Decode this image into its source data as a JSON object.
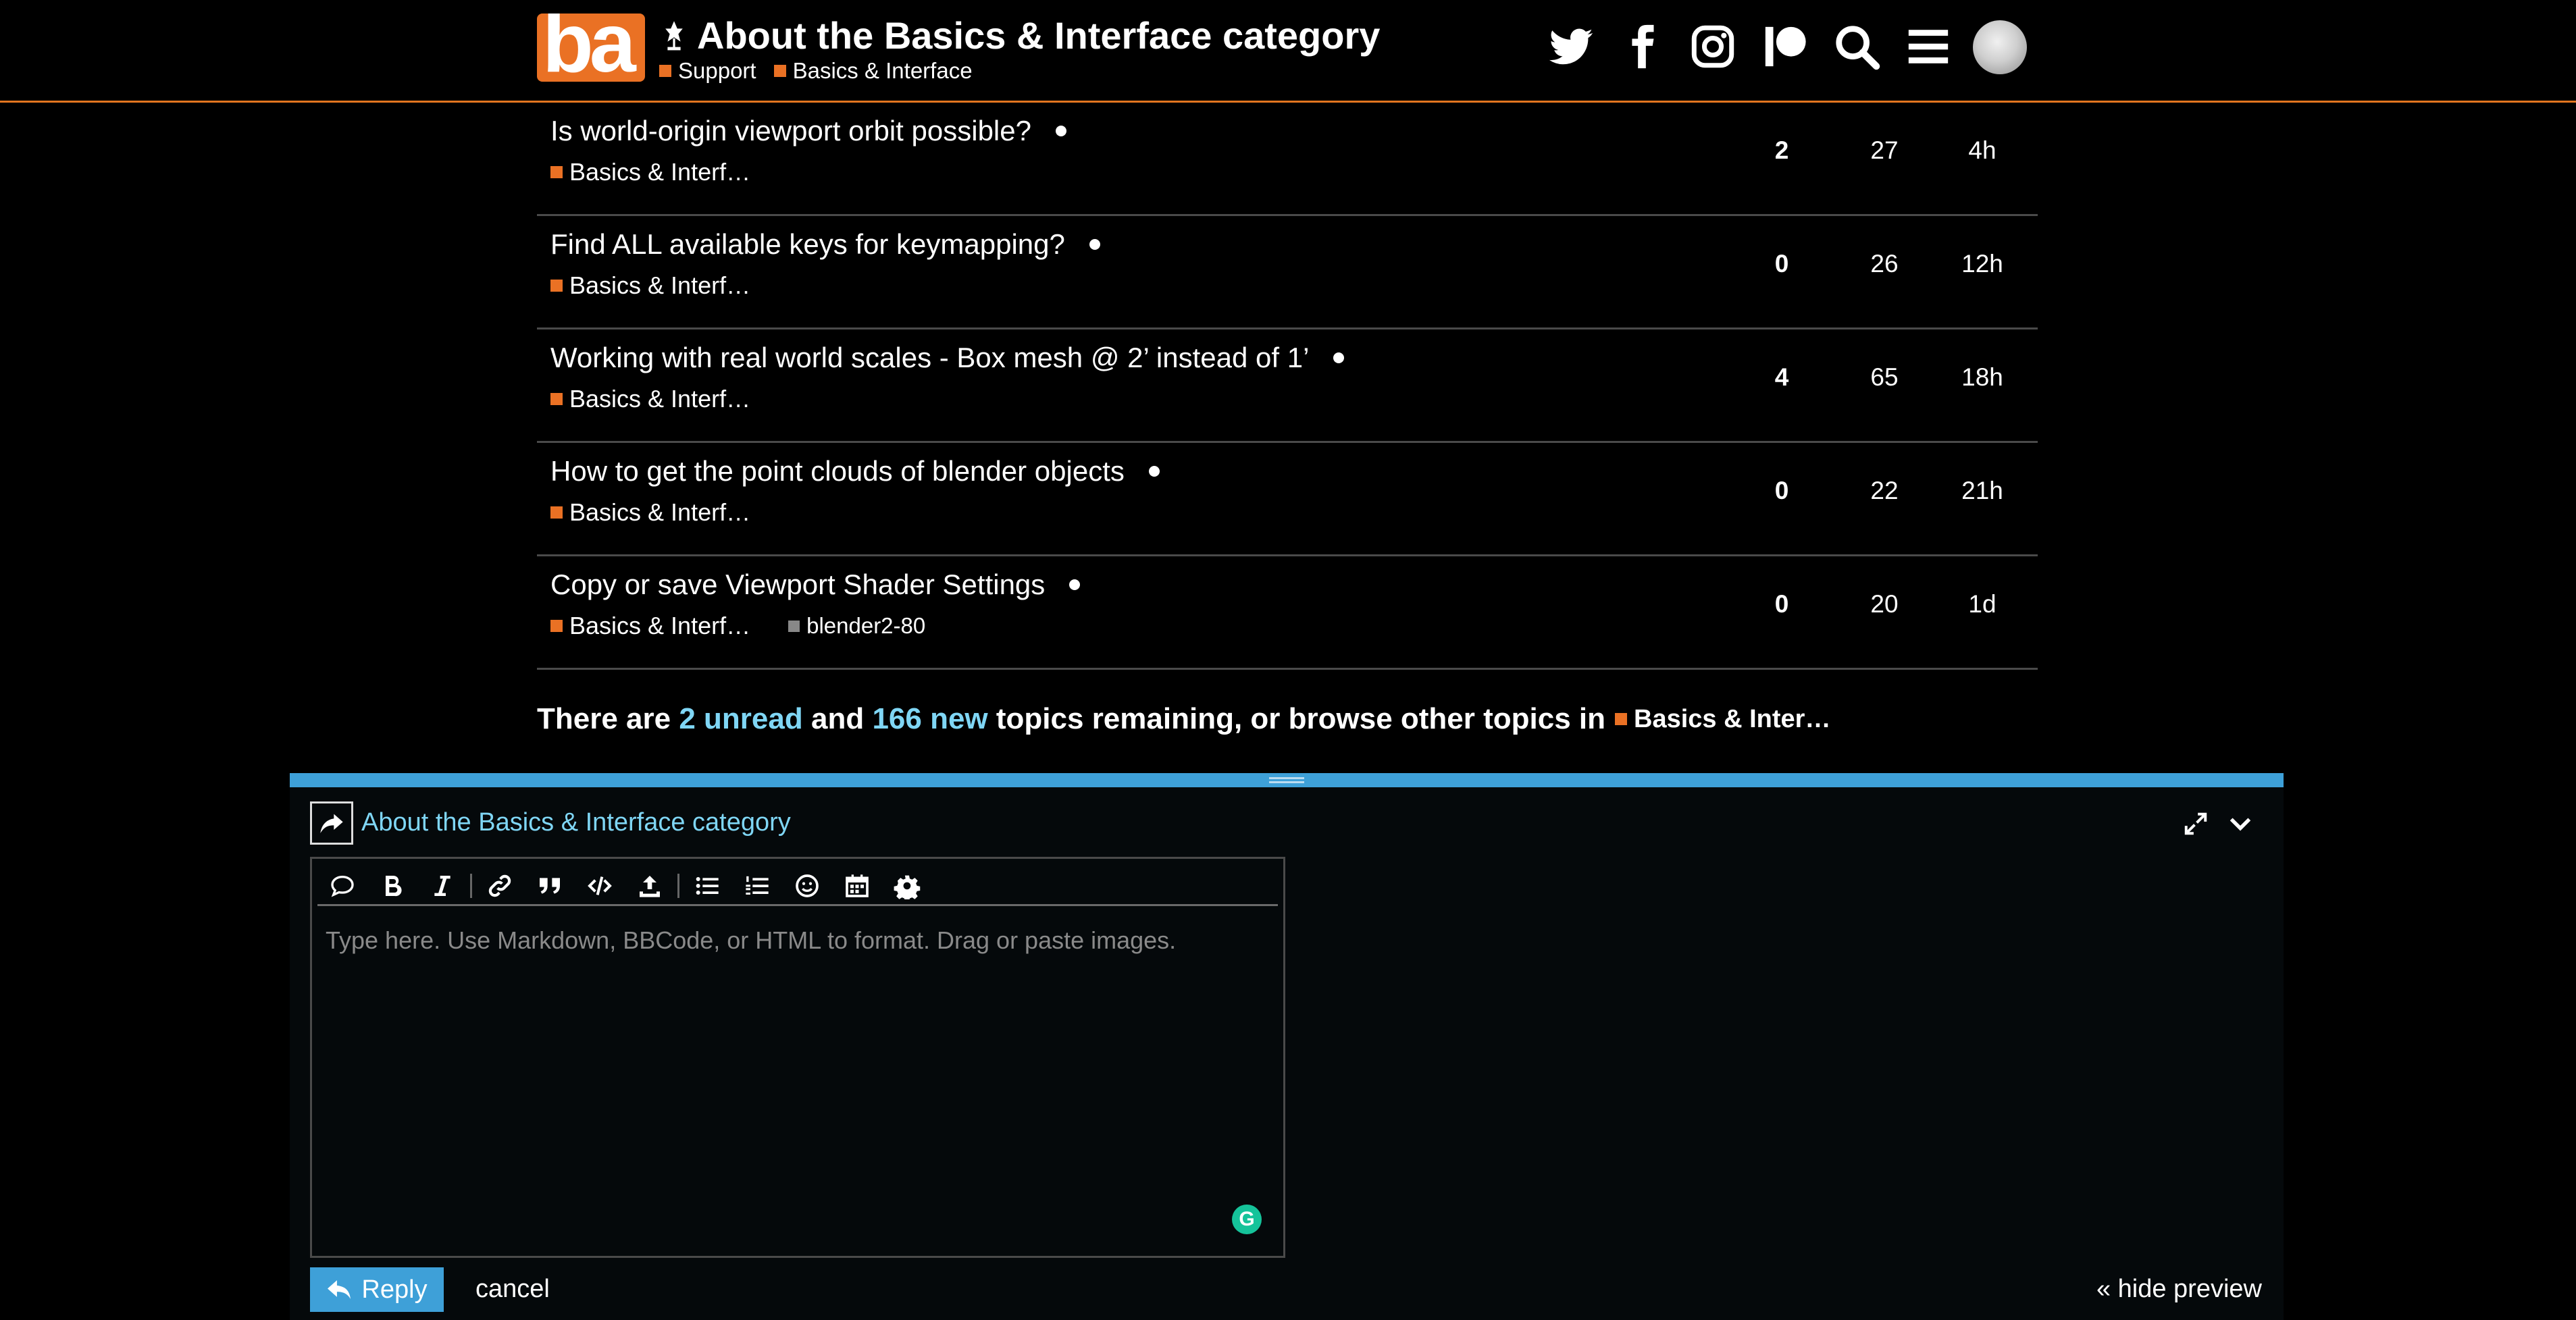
{
  "header": {
    "logo_text": "ba",
    "title": "About the Basics & Interface category",
    "breadcrumbs": [
      {
        "label": "Support",
        "color": "#ea7124"
      },
      {
        "label": "Basics & Interface",
        "color": "#ea7124"
      }
    ],
    "icons": [
      "twitter-icon",
      "facebook-icon",
      "instagram-icon",
      "patreon-icon",
      "search-icon",
      "hamburger-menu-icon",
      "avatar"
    ],
    "accent_color": "#e2751f"
  },
  "topics": [
    {
      "title": "Is world-origin viewport orbit possible?",
      "category": "Basics & Interf…",
      "tags": [],
      "replies": "2",
      "views": "27",
      "activity": "4h"
    },
    {
      "title": "Find ALL available keys for keymapping?",
      "category": "Basics & Interf…",
      "tags": [],
      "replies": "0",
      "views": "26",
      "activity": "12h"
    },
    {
      "title": "Working with real world scales - Box mesh @ 2’ instead of 1’",
      "category": "Basics & Interf…",
      "tags": [],
      "replies": "4",
      "views": "65",
      "activity": "18h"
    },
    {
      "title": "How to get the point clouds of blender objects",
      "category": "Basics & Interf…",
      "tags": [],
      "replies": "0",
      "views": "22",
      "activity": "21h"
    },
    {
      "title": "Copy or save Viewport Shader Settings",
      "category": "Basics & Interf…",
      "tags": [
        "blender2-80"
      ],
      "replies": "0",
      "views": "20",
      "activity": "1d"
    }
  ],
  "remaining": {
    "prefix": "There are",
    "unread": "2 unread",
    "and": "and",
    "new": "166 new",
    "suffix": "topics remaining, or browse other topics in",
    "category": "Basics & Inter…"
  },
  "composer": {
    "reply_to": "About the Basics & Interface category",
    "placeholder": "Type here. Use Markdown, BBCode, or HTML to format. Drag or paste images.",
    "reply_label": "Reply",
    "cancel_label": "cancel",
    "hide_preview_label": "« hide preview",
    "grammarly_badge": "G",
    "toolbar": [
      "quote-icon",
      "bold-icon",
      "italic-icon",
      "link-icon",
      "blockquote-icon",
      "code-icon",
      "upload-icon",
      "bullet-list-icon",
      "numbered-list-icon",
      "emoji-icon",
      "calendar-icon",
      "gear-icon"
    ],
    "accent_color": "#3ea0d8"
  }
}
